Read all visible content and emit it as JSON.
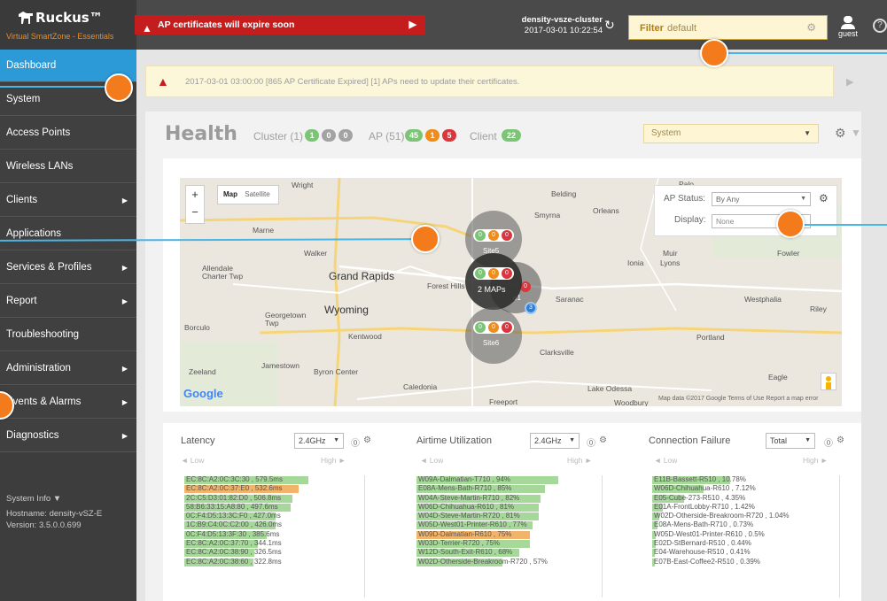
{
  "brand": {
    "name": "Ruckus™",
    "subtitle": "Virtual SmartZone - Essentials"
  },
  "header": {
    "alert_text": "AP certificates will expire soon",
    "cluster_name": "density-vsze-cluster",
    "cluster_time": "2017-03-01  10:22:54",
    "filter_label": "Filter",
    "filter_value": "default",
    "user": "guest",
    "help_icon": "?"
  },
  "sidebar": {
    "items": [
      {
        "label": "Dashboard",
        "active": true,
        "arrow": false
      },
      {
        "label": "System",
        "arrow": false
      },
      {
        "label": "Access Points",
        "arrow": false
      },
      {
        "label": "Wireless LANs",
        "arrow": false
      },
      {
        "label": "Clients",
        "arrow": true
      },
      {
        "label": "Applications",
        "arrow": false
      },
      {
        "label": "Services & Profiles",
        "arrow": true
      },
      {
        "label": "Report",
        "arrow": true
      },
      {
        "label": "Troubleshooting",
        "arrow": false
      },
      {
        "label": "Administration",
        "arrow": true
      },
      {
        "label": "Events & Alarms",
        "arrow": true
      },
      {
        "label": "Diagnostics",
        "arrow": true
      }
    ],
    "system_info_title": "System Info ▼",
    "hostname": "Hostname:  density-vSZ-E",
    "version": "Version:    3.5.0.0.699"
  },
  "notice": {
    "text": "2017-03-01 03:00:00 [865 AP Certificate Expired] [1] APs need to update their certificates."
  },
  "health": {
    "title": "Health",
    "cluster_label": "Cluster (1)",
    "cluster_counts": [
      "1",
      "0",
      "0"
    ],
    "ap_label": "AP (51)",
    "ap_counts": [
      "45",
      "1",
      "5"
    ],
    "client_label": "Client",
    "client_count": "22",
    "scope": "System"
  },
  "map": {
    "map_btn": "Map",
    "satellite_btn": "Satellite",
    "ap_status_label": "AP Status:",
    "ap_status_value": "By Any",
    "display_label": "Display:",
    "display_value": "None",
    "google": "Google",
    "footer": "Map data ©2017 Google   Terms of Use   Report a map error",
    "cities": {
      "grand_rapids": "Grand Rapids",
      "wyoming": "Wyoming",
      "kentwood": "Kentwood",
      "walker": "Walker",
      "marne": "Marne",
      "wright": "Wright",
      "allendale": "Allendale\nCharter Twp",
      "georgetown": "Georgetown\nTwp",
      "borculo": "Borculo",
      "zeeland": "Zeeland",
      "jamestown": "Jamestown",
      "byron": "Byron Center",
      "caledonia": "Caledonia",
      "forest_hills": "Forest Hills",
      "belding": "Belding",
      "smyrna": "Smyrna",
      "orleans": "Orleans",
      "ionia": "Ionia",
      "saranac": "Saranac",
      "muir": "Muir",
      "lyons": "Lyons",
      "fowler": "Fowler",
      "westphalia": "Westphalia",
      "riley": "Riley",
      "portland": "Portland",
      "clarksville": "Clarksville",
      "lake_odessa": "Lake Odessa",
      "freeport": "Freeport",
      "eagle": "Eagle",
      "palo": "Palo",
      "woodbury": "Woodbury"
    },
    "clusters": [
      {
        "name": "Site5",
        "counts": [
          "0",
          "0",
          "0"
        ]
      },
      {
        "name": "2 MAPs",
        "counts": [
          "0",
          "0",
          "0"
        ]
      },
      {
        "name": "Site6",
        "counts": [
          "0",
          "0",
          "0"
        ]
      }
    ],
    "partial_site": "e1",
    "partial_count": "0",
    "marker_count": "3"
  },
  "latency": {
    "title": "Latency",
    "band": "2.4GHz",
    "low": "◄ Low",
    "high": "High ►",
    "rows": [
      {
        "label": "EC:8C:A2:0C:3C:30 , 579.5ms",
        "value": 579.5,
        "color": "#a6d89a"
      },
      {
        "label": "EC:8C:A2:0C:37:E0 , 532.6ms",
        "value": 532.6,
        "color": "#f2b36b"
      },
      {
        "label": "2C:C5:D3:01:82:D0 , 506.8ms",
        "value": 506.8,
        "color": "#a6d89a"
      },
      {
        "label": "58:B6:33:15:A8:80 , 497.6ms",
        "value": 497.6,
        "color": "#a6d89a"
      },
      {
        "label": "0C:F4:D5:13:3C:F0 , 427.0ms",
        "value": 427.0,
        "color": "#a6d89a"
      },
      {
        "label": "1C:B9:C4:0C:C2:00 , 426.0ms",
        "value": 426.0,
        "color": "#a6d89a"
      },
      {
        "label": "0C:F4:D5:13:3F:30 , 385.6ms",
        "value": 385.6,
        "color": "#a6d89a"
      },
      {
        "label": "EC:8C:A2:0C:37:70 , 344.1ms",
        "value": 344.1,
        "color": "#a6d89a"
      },
      {
        "label": "EC:8C:A2:0C:38:90 , 326.5ms",
        "value": 326.5,
        "color": "#a6d89a"
      },
      {
        "label": "EC:8C:A2:0C:38:60 , 322.8ms",
        "value": 322.8,
        "color": "#a6d89a"
      }
    ]
  },
  "airtime": {
    "title": "Airtime Utilization",
    "band": "2.4GHz",
    "low": "◄ Low",
    "high": "High ►",
    "rows": [
      {
        "label": "W09A-Dalmatian-T710 , 94%",
        "value": 94,
        "color": "#a6d89a"
      },
      {
        "label": "E08A-Mens-Bath-R710 , 85%",
        "value": 85,
        "color": "#a6d89a"
      },
      {
        "label": "W04A-Steve-Martin-R710 , 82%",
        "value": 82,
        "color": "#a6d89a"
      },
      {
        "label": "W06D-Chihuahua-R610 , 81%",
        "value": 81,
        "color": "#a6d89a"
      },
      {
        "label": "W04D-Steve-Martin-R720 , 81%",
        "value": 81,
        "color": "#a6d89a"
      },
      {
        "label": "W05D-West01-Printer-R610 , 77%",
        "value": 77,
        "color": "#a6d89a"
      },
      {
        "label": "W09D-Dalmatian-R610 , 75%",
        "value": 75,
        "color": "#f2b36b"
      },
      {
        "label": "W03D-Terrier-R720 , 75%",
        "value": 75,
        "color": "#a6d89a"
      },
      {
        "label": "W12D-South-Exit-R610 , 68%",
        "value": 68,
        "color": "#a6d89a"
      },
      {
        "label": "W02D-Otherside-Breakroom-R720 , 57%",
        "value": 57,
        "color": "#a6d89a"
      }
    ]
  },
  "connfail": {
    "title": "Connection Failure",
    "band": "Total",
    "low": "◄ Low",
    "high": "High ►",
    "rows": [
      {
        "label": "E11B-Bassett-R510 , 10.78%",
        "value": 10.78,
        "color": "#a6d89a"
      },
      {
        "label": "W06D-Chihuahua-R610 , 7.12%",
        "value": 7.12,
        "color": "#a6d89a"
      },
      {
        "label": "E05-Cube-273-R510 , 4.35%",
        "value": 4.35,
        "color": "#a6d89a"
      },
      {
        "label": "E01A-FrontLobby-R710 , 1.42%",
        "value": 1.42,
        "color": "#a6d89a"
      },
      {
        "label": "W02D-Otherside-Breakroom-R720 , 1.04%",
        "value": 1.04,
        "color": "#a6d89a"
      },
      {
        "label": "E08A-Mens-Bath-R710 , 0.73%",
        "value": 0.73,
        "color": "#a6d89a"
      },
      {
        "label": "W05D-West01-Printer-R610 , 0.5%",
        "value": 0.5,
        "color": "#a6d89a"
      },
      {
        "label": "E02D-StBernard-R510 , 0.44%",
        "value": 0.44,
        "color": "#a6d89a"
      },
      {
        "label": "E04-Warehouse-R510 , 0.41%",
        "value": 0.41,
        "color": "#a6d89a"
      },
      {
        "label": "E07B-East-Coffee2-R510 , 0.39%",
        "value": 0.39,
        "color": "#a6d89a"
      }
    ]
  },
  "colors": {
    "accent": "#2b9ad6",
    "alert": "#c51d1d",
    "green": "#7cc576",
    "orange": "#f08c1b",
    "red": "#d9363e",
    "gray": "#a3a3a3",
    "callout": "#f47b1c",
    "callout_line": "#49b5e5"
  }
}
